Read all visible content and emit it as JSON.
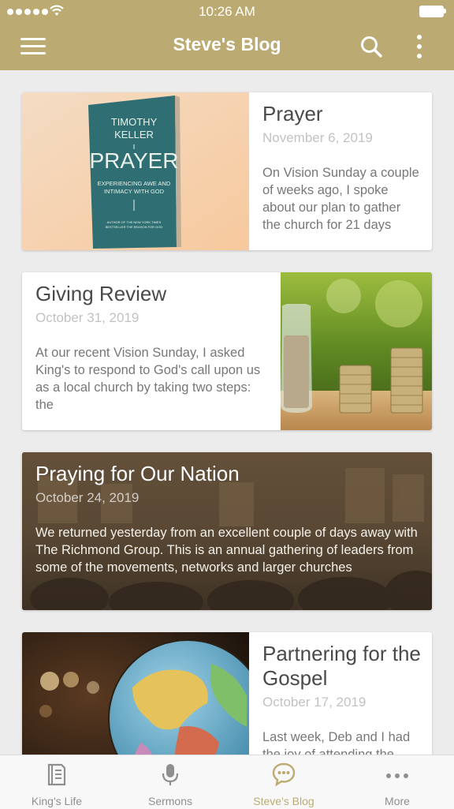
{
  "status_bar": {
    "time": "10:26 AM"
  },
  "nav": {
    "title": "Steve's Blog"
  },
  "posts": [
    {
      "title": "Prayer",
      "date": "November 6, 2019",
      "excerpt": "On Vision Sunday a couple of weeks ago, I spoke about our plan to gather the church for 21 days",
      "book_cover_lines": [
        "TIMOTHY",
        "KELLER",
        "PRAYER",
        "EXPERIENCING AWE AND",
        "INTIMACY WITH GOD",
        "AUTHOR OF THE NEW YORK TIMES",
        "BESTSELLER THE REASON FOR GOD"
      ]
    },
    {
      "title": "Giving Review",
      "date": "October 31, 2019",
      "excerpt": "At our recent Vision Sunday, I asked King's to respond to God's call upon us as a local church by taking two steps: the"
    },
    {
      "title": "Praying for Our Nation",
      "date": "October 24, 2019",
      "excerpt": "We returned yesterday from an excellent couple of days away with The Richmond Group. This is an annual gathering of leaders from some of the movements, networks and larger churches"
    },
    {
      "title": "Partnering for the Gospel",
      "date": "October 17, 2019",
      "excerpt": "Last week, Deb and I had the joy of attending the"
    }
  ],
  "tabs": [
    {
      "label": "King's Life",
      "icon": "book-icon",
      "active": false
    },
    {
      "label": "Sermons",
      "icon": "microphone-icon",
      "active": false
    },
    {
      "label": "Steve's Blog",
      "icon": "speech-bubble-icon",
      "active": true
    },
    {
      "label": "More",
      "icon": "ellipsis-icon",
      "active": false
    }
  ],
  "colors": {
    "accent": "#bbab73",
    "background": "#ececec",
    "tab_inactive": "#8f8f8f"
  }
}
